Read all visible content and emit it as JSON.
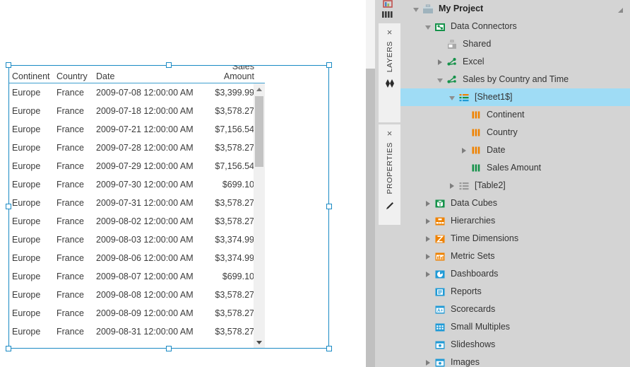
{
  "grid": {
    "columns": [
      "Continent",
      "Country",
      "Date",
      "Sales Amount"
    ],
    "rows": [
      {
        "continent": "Europe",
        "country": "France",
        "date": "2009-07-08 12:00:00 AM",
        "sales": "$3,399.99"
      },
      {
        "continent": "Europe",
        "country": "France",
        "date": "2009-07-18 12:00:00 AM",
        "sales": "$3,578.27"
      },
      {
        "continent": "Europe",
        "country": "France",
        "date": "2009-07-21 12:00:00 AM",
        "sales": "$7,156.54"
      },
      {
        "continent": "Europe",
        "country": "France",
        "date": "2009-07-28 12:00:00 AM",
        "sales": "$3,578.27"
      },
      {
        "continent": "Europe",
        "country": "France",
        "date": "2009-07-29 12:00:00 AM",
        "sales": "$7,156.54"
      },
      {
        "continent": "Europe",
        "country": "France",
        "date": "2009-07-30 12:00:00 AM",
        "sales": "$699.10"
      },
      {
        "continent": "Europe",
        "country": "France",
        "date": "2009-07-31 12:00:00 AM",
        "sales": "$3,578.27"
      },
      {
        "continent": "Europe",
        "country": "France",
        "date": "2009-08-02 12:00:00 AM",
        "sales": "$3,578.27"
      },
      {
        "continent": "Europe",
        "country": "France",
        "date": "2009-08-03 12:00:00 AM",
        "sales": "$3,374.99"
      },
      {
        "continent": "Europe",
        "country": "France",
        "date": "2009-08-06 12:00:00 AM",
        "sales": "$3,374.99"
      },
      {
        "continent": "Europe",
        "country": "France",
        "date": "2009-08-07 12:00:00 AM",
        "sales": "$699.10"
      },
      {
        "continent": "Europe",
        "country": "France",
        "date": "2009-08-08 12:00:00 AM",
        "sales": "$3,578.27"
      },
      {
        "continent": "Europe",
        "country": "France",
        "date": "2009-08-09 12:00:00 AM",
        "sales": "$3,578.27"
      },
      {
        "continent": "Europe",
        "country": "France",
        "date": "2009-08-31 12:00:00 AM",
        "sales": "$3,578.27"
      }
    ]
  },
  "dock": {
    "tabs": [
      {
        "label": "LAYERS",
        "icon": "layers-icon",
        "close": "×"
      },
      {
        "label": "PROPERTIES",
        "icon": "pencil-icon",
        "close": "×"
      }
    ]
  },
  "tree": {
    "items": [
      {
        "label": "My Project",
        "indent": 0,
        "twisty": "open",
        "icon": "project-briefcase-icon",
        "bold": true,
        "selected": false
      },
      {
        "label": "Data Connectors",
        "indent": 1,
        "twisty": "open",
        "icon": "data-connectors-folder-icon",
        "bold": false,
        "selected": false
      },
      {
        "label": "Shared",
        "indent": 2,
        "twisty": "none",
        "icon": "shared-briefcase-icon",
        "bold": false,
        "selected": false
      },
      {
        "label": "Excel",
        "indent": 2,
        "twisty": "closed",
        "icon": "connector-node-icon",
        "bold": false,
        "selected": false
      },
      {
        "label": "Sales by Country and Time",
        "indent": 2,
        "twisty": "open",
        "icon": "connector-node-icon",
        "bold": false,
        "selected": false
      },
      {
        "label": "[Sheet1$]",
        "indent": 3,
        "twisty": "open",
        "icon": "table-list-icon",
        "bold": false,
        "selected": true
      },
      {
        "label": "Continent",
        "indent": 4,
        "twisty": "none",
        "icon": "column-orange-icon",
        "bold": false,
        "selected": false
      },
      {
        "label": "Country",
        "indent": 4,
        "twisty": "none",
        "icon": "column-orange-icon",
        "bold": false,
        "selected": false
      },
      {
        "label": "Date",
        "indent": 4,
        "twisty": "closed",
        "icon": "column-orange-icon",
        "bold": false,
        "selected": false
      },
      {
        "label": "Sales Amount",
        "indent": 4,
        "twisty": "none",
        "icon": "column-green-icon",
        "bold": false,
        "selected": false
      },
      {
        "label": "[Table2]",
        "indent": 3,
        "twisty": "closed",
        "icon": "table-list-gray-icon",
        "bold": false,
        "selected": false
      },
      {
        "label": "Data Cubes",
        "indent": 1,
        "twisty": "closed",
        "icon": "data-cube-icon",
        "bold": false,
        "selected": false
      },
      {
        "label": "Hierarchies",
        "indent": 1,
        "twisty": "closed",
        "icon": "hierarchies-icon",
        "bold": false,
        "selected": false
      },
      {
        "label": "Time Dimensions",
        "indent": 1,
        "twisty": "closed",
        "icon": "time-dimensions-icon",
        "bold": false,
        "selected": false
      },
      {
        "label": "Metric Sets",
        "indent": 1,
        "twisty": "closed",
        "icon": "metric-sets-icon",
        "bold": false,
        "selected": false
      },
      {
        "label": "Dashboards",
        "indent": 1,
        "twisty": "closed",
        "icon": "dashboards-icon",
        "bold": false,
        "selected": false
      },
      {
        "label": "Reports",
        "indent": 1,
        "twisty": "none",
        "icon": "reports-icon",
        "bold": false,
        "selected": false
      },
      {
        "label": "Scorecards",
        "indent": 1,
        "twisty": "none",
        "icon": "scorecards-icon",
        "bold": false,
        "selected": false
      },
      {
        "label": "Small Multiples",
        "indent": 1,
        "twisty": "none",
        "icon": "small-multiples-icon",
        "bold": false,
        "selected": false
      },
      {
        "label": "Slideshows",
        "indent": 1,
        "twisty": "none",
        "icon": "slideshows-icon",
        "bold": false,
        "selected": false
      },
      {
        "label": "Images",
        "indent": 1,
        "twisty": "closed",
        "icon": "images-icon",
        "bold": false,
        "selected": false
      }
    ]
  },
  "colors": {
    "selection": "#1a8ac4",
    "tree_selection": "#9fdcf5",
    "panel_bg": "#d4d4d4",
    "orange": "#ef8200",
    "green": "#15924a",
    "blue": "#1f9ad6"
  }
}
